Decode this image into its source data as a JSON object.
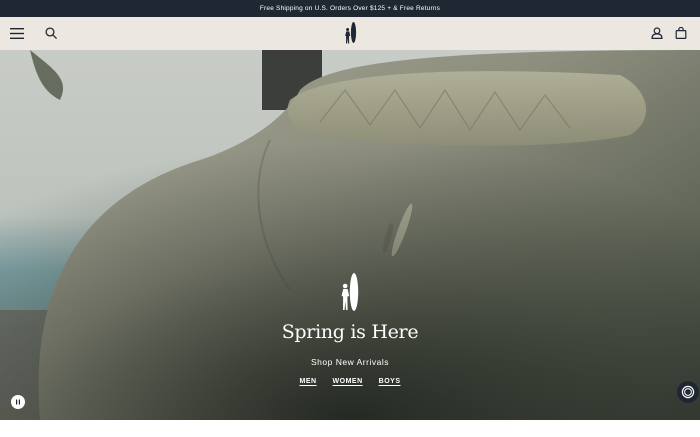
{
  "announcement": {
    "text": "Free Shipping on U.S. Orders Over $125 + & Free Returns"
  },
  "header": {
    "menu_icon": "hamburger-menu-icon",
    "search_icon": "search-icon",
    "logo": "surfer-logo",
    "account_icon": "account-icon",
    "cart_icon": "shopping-bag-icon"
  },
  "hero": {
    "title": "Spring is Here",
    "subtitle": "Shop New Arrivals",
    "links": [
      "MEN",
      "WOMEN",
      "BOYS"
    ],
    "pause_icon": "pause-icon",
    "chat_icon": "chat-icon"
  },
  "colors": {
    "announcement_bg": "#1f2733",
    "header_bg": "#ece8e1",
    "text_light": "#ffffff"
  }
}
